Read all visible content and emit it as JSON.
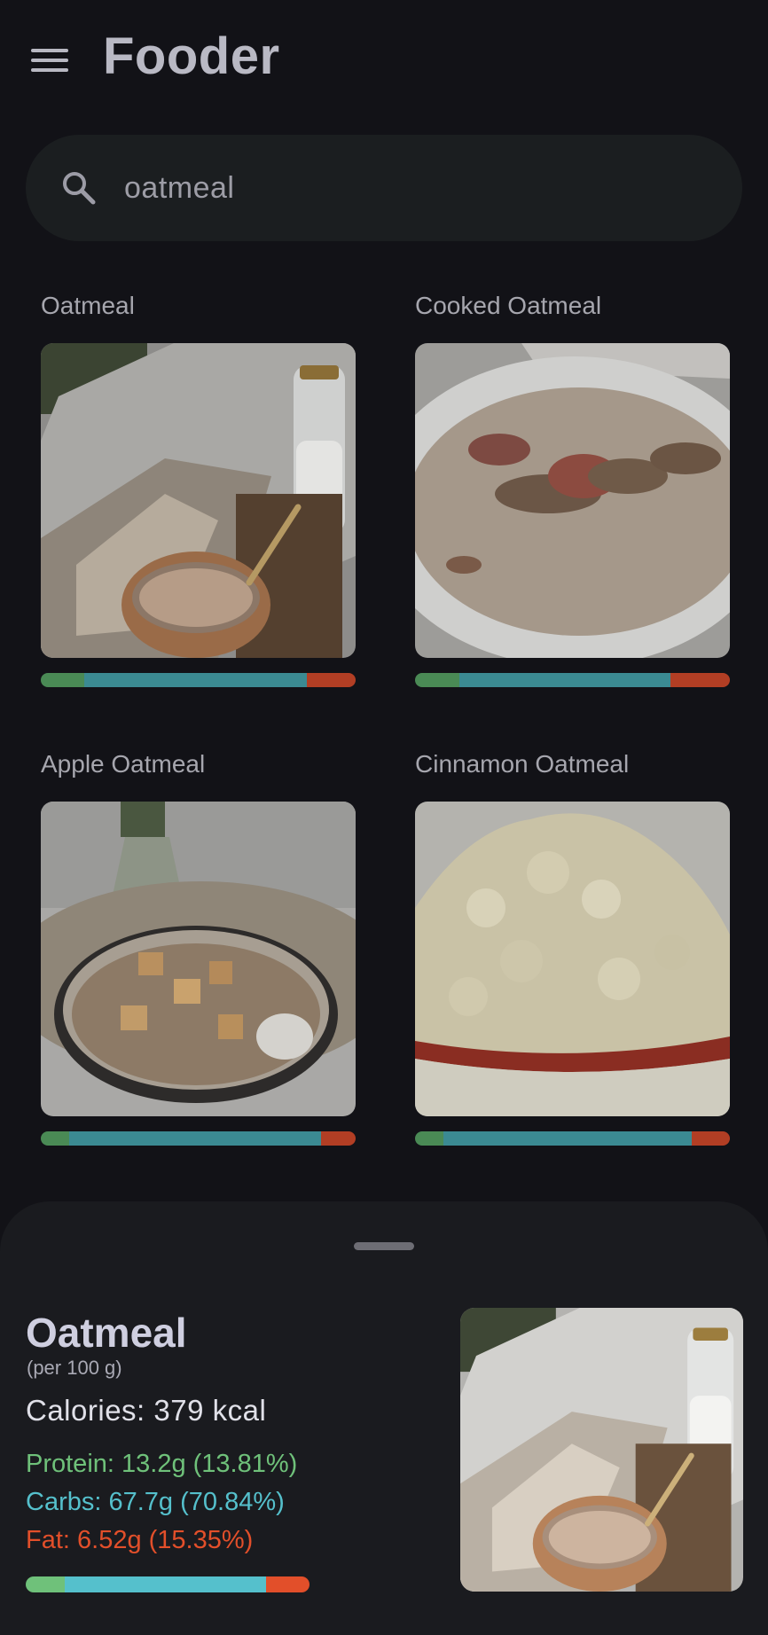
{
  "app": {
    "title": "Fooder"
  },
  "colors": {
    "background": "#121217",
    "protein": "#6fc17a",
    "carbs": "#55c0cc",
    "fat": "#e24f2a",
    "protein_dim": "#4a8a55",
    "carbs_dim": "#3b8a92",
    "fat_dim": "#b23e24"
  },
  "icons": {
    "menu": "hamburger-menu-icon",
    "search": "search-icon"
  },
  "search": {
    "value": "oatmeal"
  },
  "results": [
    {
      "name": "Oatmeal",
      "macro": {
        "protein": 13.81,
        "carbs": 70.84,
        "fat": 15.35
      }
    },
    {
      "name": "Cooked Oatmeal",
      "macro": {
        "protein": 14,
        "carbs": 67,
        "fat": 19
      }
    },
    {
      "name": "Apple Oatmeal",
      "macro": {
        "protein": 9,
        "carbs": 80,
        "fat": 11
      }
    },
    {
      "name": "Cinnamon Oatmeal",
      "macro": {
        "protein": 9,
        "carbs": 79,
        "fat": 12
      }
    }
  ],
  "detail": {
    "name": "Oatmeal",
    "per": "(per 100 g)",
    "calories": "Calories: 379 kcal",
    "protein": "Protein: 13.2g (13.81%)",
    "carbs": "Carbs: 67.7g (70.84%)",
    "fat": "Fat: 6.52g (15.35%)",
    "macro": {
      "protein": 13.81,
      "carbs": 70.84,
      "fat": 15.35
    }
  }
}
